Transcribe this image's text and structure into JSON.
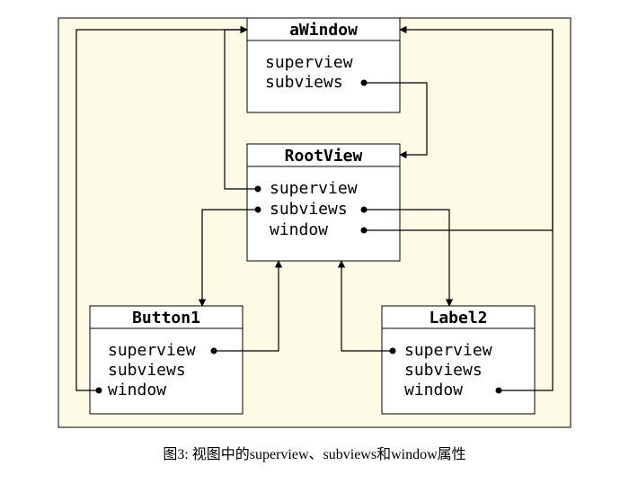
{
  "nodes": {
    "aWindow": {
      "title": "aWindow",
      "props": [
        "superview",
        "subviews"
      ]
    },
    "rootView": {
      "title": "RootView",
      "props": [
        "superview",
        "subviews",
        "window"
      ]
    },
    "button1": {
      "title": "Button1",
      "props": [
        "superview",
        "subviews",
        "window"
      ]
    },
    "label2": {
      "title": "Label2",
      "props": [
        "superview",
        "subviews",
        "window"
      ]
    }
  },
  "caption": "图3: 视图中的superview、subviews和window属性",
  "chart_data": {
    "type": "diagram",
    "description": "View hierarchy: aWindow -> RootView -> [Button1, Label2]; each child back-references its superview and the window",
    "nodes": [
      "aWindow",
      "RootView",
      "Button1",
      "Label2"
    ],
    "edges": [
      {
        "from": "aWindow",
        "prop": "subviews",
        "to": "RootView"
      },
      {
        "from": "RootView",
        "prop": "superview",
        "to": "aWindow"
      },
      {
        "from": "RootView",
        "prop": "subviews",
        "to": "Button1"
      },
      {
        "from": "RootView",
        "prop": "subviews",
        "to": "Label2"
      },
      {
        "from": "RootView",
        "prop": "window",
        "to": "aWindow"
      },
      {
        "from": "Button1",
        "prop": "superview",
        "to": "RootView"
      },
      {
        "from": "Button1",
        "prop": "window",
        "to": "aWindow"
      },
      {
        "from": "Label2",
        "prop": "superview",
        "to": "RootView"
      },
      {
        "from": "Label2",
        "prop": "window",
        "to": "aWindow"
      }
    ]
  }
}
